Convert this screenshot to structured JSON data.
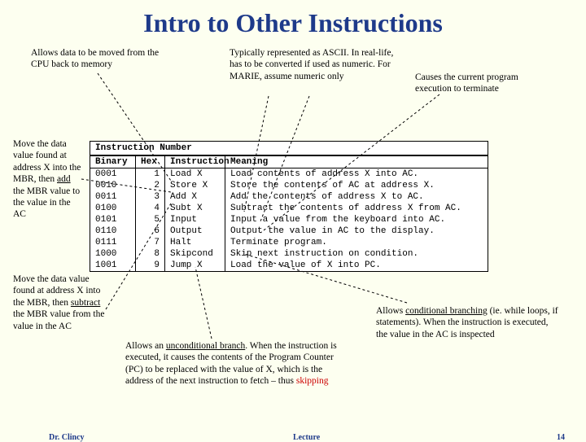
{
  "title": "Intro to Other  Instructions",
  "annotations": {
    "top_left": "Allows data to be moved from the CPU back to memory",
    "top_mid": "Typically represented as ASCII. In real-life, has to be converted if used as numeric. For MARIE, assume numeric only",
    "top_right": "Causes the current program execution to terminate",
    "left_upper_pre": "Move the data value found at address X into the MBR, then ",
    "left_upper_em": "add",
    "left_upper_post": " the MBR value to the value in the AC",
    "left_lower_pre": "Move the data value found at address X into the MBR, then ",
    "left_lower_em": "subtract",
    "left_lower_post": " the MBR value from the value in the AC",
    "bottom_mid_pre": "Allows an ",
    "bottom_mid_u": "unconditional branch",
    "bottom_mid_post": ". When the instruction is executed, it causes the contents of the Program Counter (PC) to be replaced with the value of X, which is the address of the next instruction to fetch – thus ",
    "bottom_mid_em": "skipping",
    "bottom_right_pre": "Allows ",
    "bottom_right_u": "conditional branching",
    "bottom_right_post": " (ie. while loops, if statements). When the instruction is executed, the value in the AC is inspected"
  },
  "table": {
    "group_header": "Instruction Number",
    "headers": {
      "c1": "Binary",
      "c2": "Hex",
      "c3": "Instruction",
      "c4": "Meaning"
    },
    "rows": [
      {
        "c1": "0001",
        "c2": "1",
        "c3": "Load X",
        "c4": "Load contents of address X into AC."
      },
      {
        "c1": "0010",
        "c2": "2",
        "c3": "Store X",
        "c4": "Store the contents of AC at address X."
      },
      {
        "c1": "0011",
        "c2": "3",
        "c3": "Add X",
        "c4": "Add the contents of address X to AC."
      },
      {
        "c1": "0100",
        "c2": "4",
        "c3": "Subt X",
        "c4": "Subtract the contents of address X from AC."
      },
      {
        "c1": "0101",
        "c2": "5",
        "c3": "Input",
        "c4": "Input a value from the keyboard into AC."
      },
      {
        "c1": "0110",
        "c2": "6",
        "c3": "Output",
        "c4": "Output the value in AC to the display."
      },
      {
        "c1": "0111",
        "c2": "7",
        "c3": "Halt",
        "c4": "Terminate program."
      },
      {
        "c1": "1000",
        "c2": "8",
        "c3": "Skipcond",
        "c4": "Skip next instruction on condition."
      },
      {
        "c1": "1001",
        "c2": "9",
        "c3": "Jump X",
        "c4": "Load the value of X into PC."
      }
    ]
  },
  "footer": {
    "left": "Dr. Clincy",
    "center": "Lecture",
    "right": "14"
  }
}
